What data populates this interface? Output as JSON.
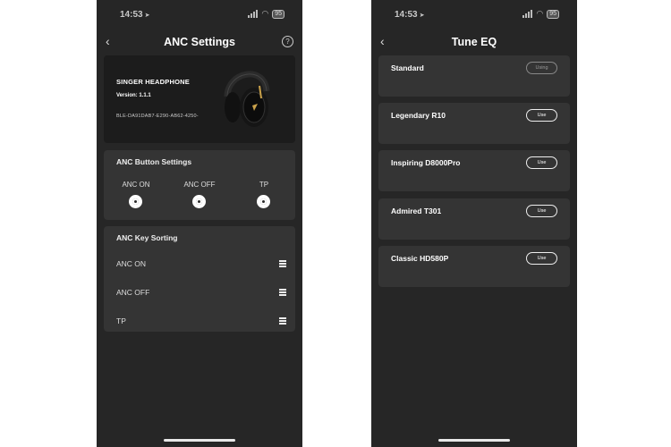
{
  "left": {
    "time": "14:53",
    "battery": "95",
    "title": "ANC Settings",
    "back": "‹",
    "help": "?",
    "device": {
      "name": "SINGER HEADPHONE",
      "version": "Version: 1.1.1",
      "id": "BLE-DA91DAB7-E290-AB62-4250-"
    },
    "button_settings": {
      "title": "ANC Button Settings",
      "options": [
        "ANC ON",
        "ANC OFF",
        "TP"
      ]
    },
    "key_sorting": {
      "title": "ANC Key Sorting",
      "items": [
        "ANC ON",
        "ANC OFF",
        "TP"
      ]
    }
  },
  "right": {
    "time": "14:53",
    "battery": "95",
    "title": "Tune EQ",
    "back": "‹",
    "presets": [
      {
        "name": "Standard",
        "button": "Using"
      },
      {
        "name": "Legendary R10",
        "button": "Use"
      },
      {
        "name": "Inspiring D8000Pro",
        "button": "Use"
      },
      {
        "name": "Admired T301",
        "button": "Use"
      },
      {
        "name": "Classic HD580P",
        "button": "Use"
      }
    ]
  }
}
